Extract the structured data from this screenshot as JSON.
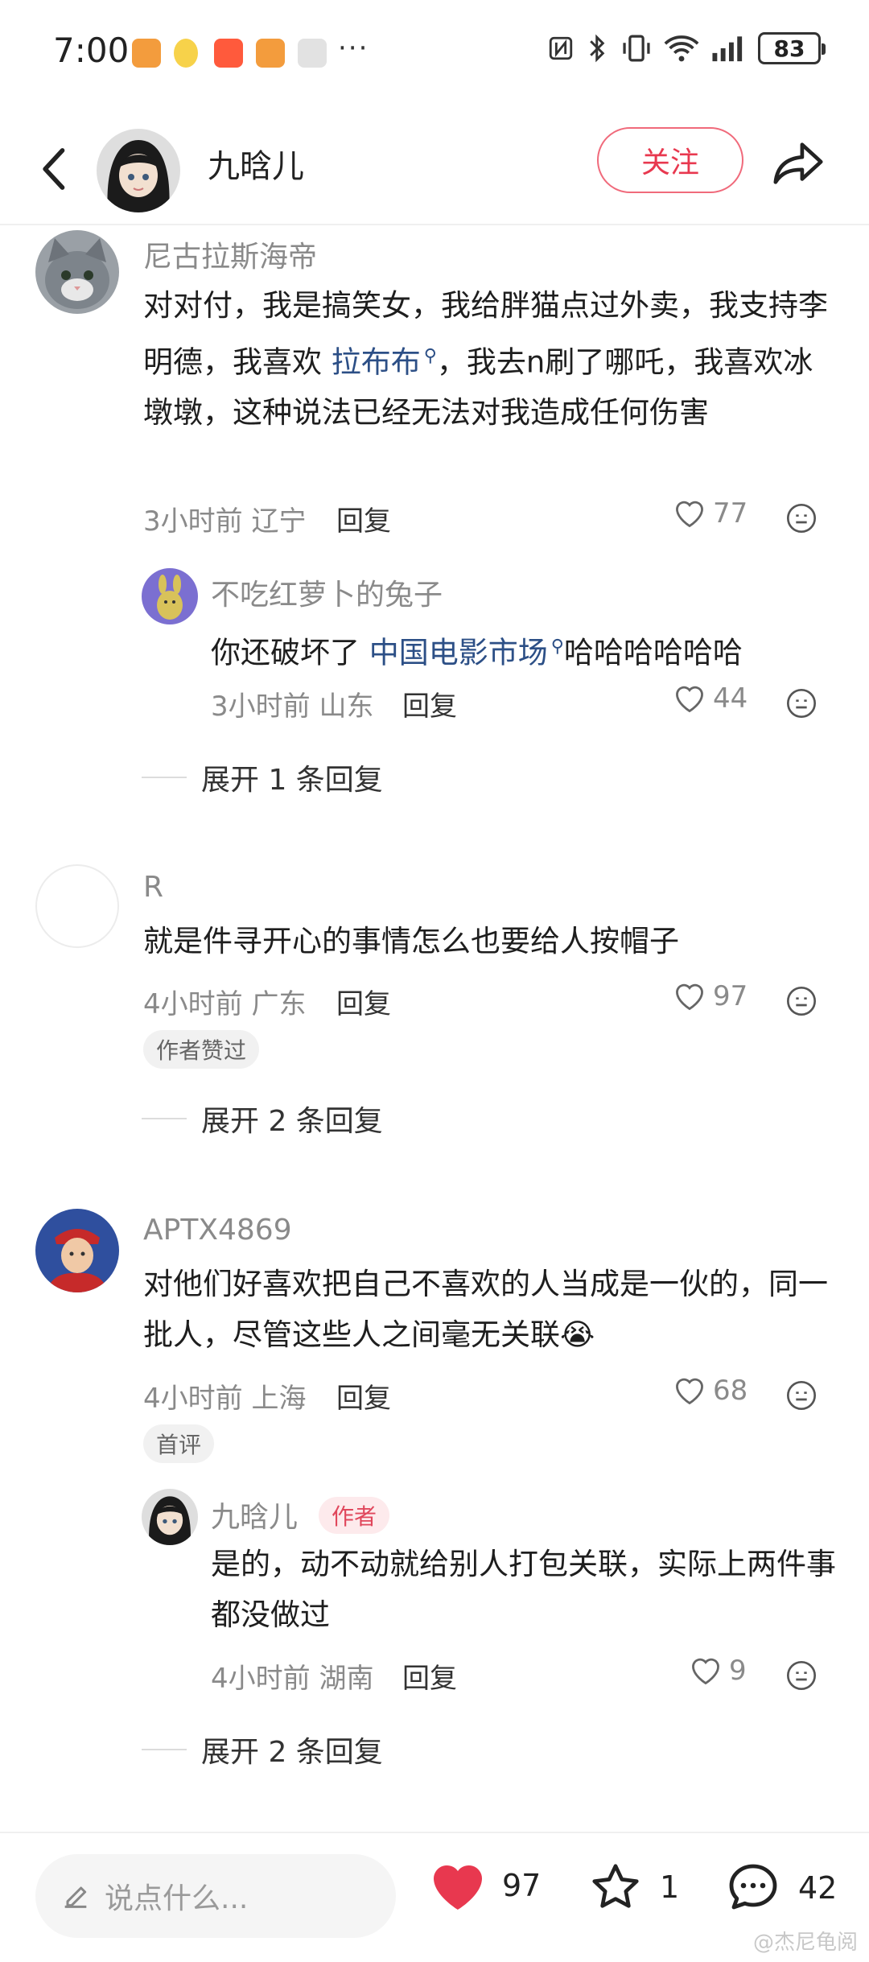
{
  "status_bar": {
    "time": "7:00",
    "more": "···",
    "battery": "83"
  },
  "header": {
    "username": "九晗儿",
    "follow_label": "关注"
  },
  "comments": [
    {
      "name": "尼古拉斯海帝",
      "text_parts": [
        "对对付，我是搞笑女，我给胖猫点过外卖，我支持李明德，我喜欢 ",
        "拉布布",
        "，我去n刷了哪吒，我喜欢冰墩墩，这种说法已经无法对我造成任何伤害"
      ],
      "time": "3小时前 辽宁",
      "reply_label": "回复",
      "likes": "77"
    },
    {
      "name": "不吃红萝卜的兔子",
      "text_parts": [
        "你还破坏了 ",
        "中国电影市场",
        "哈哈哈哈哈哈"
      ],
      "time": "3小时前 山东",
      "reply_label": "回复",
      "likes": "44"
    },
    {
      "name": "R",
      "text": "就是件寻开心的事情怎么也要给人按帽子",
      "time": "4小时前 广东",
      "reply_label": "回复",
      "likes": "97",
      "badge": "作者赞过"
    },
    {
      "name": "APTX4869",
      "text": "对他们好喜欢把自己不喜欢的人当成是一伙的，同一批人，尽管这些人之间毫无关联",
      "emoji": "😭",
      "time": "4小时前 上海",
      "reply_label": "回复",
      "likes": "68",
      "badge": "首评"
    },
    {
      "name": "九晗儿",
      "author_tag": "作者",
      "text": "是的，动不动就给别人打包关联，实际上两件事都没做过",
      "time": "4小时前 湖南",
      "reply_label": "回复",
      "likes": "9"
    }
  ],
  "expand": {
    "first": "展开 1 条回复",
    "second": "展开 2 条回复",
    "third": "展开 2 条回复"
  },
  "bottom_bar": {
    "placeholder": "说点什么...",
    "likes": "97",
    "stars": "1",
    "comments": "42",
    "watermark": "@杰尼龟阅"
  },
  "colors": {
    "accent": "#e8384f",
    "link": "#2c4f86",
    "meta": "#8a8a8a"
  }
}
